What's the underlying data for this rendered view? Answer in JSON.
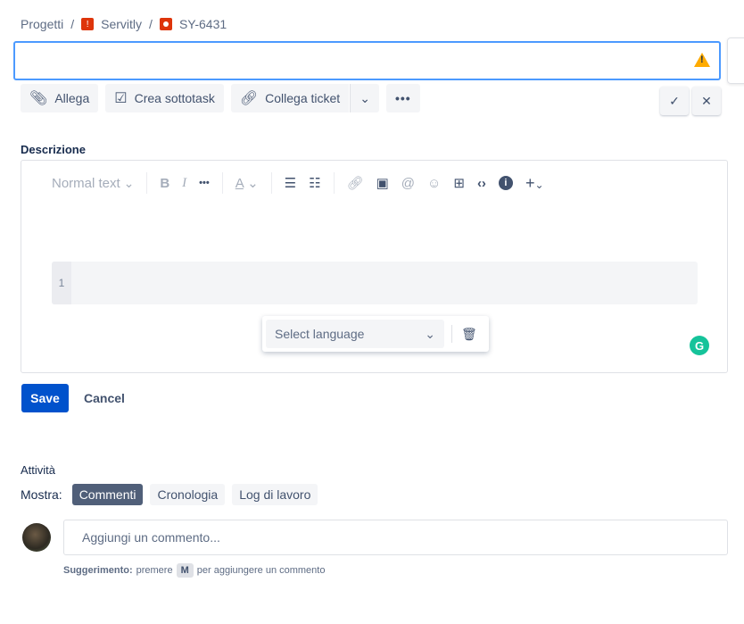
{
  "breadcrumb": {
    "root": "Progetti",
    "project": "Servitly",
    "issue": "SY-6431",
    "separator": "/"
  },
  "title_input": {
    "value": ""
  },
  "actions": {
    "attach": "Allega",
    "subtask": "Crea sottotask",
    "link": "Collega ticket"
  },
  "description": {
    "label": "Descrizione",
    "text_style": "Normal text",
    "line_number": "1",
    "select_language": "Select language"
  },
  "buttons": {
    "save": "Save",
    "cancel": "Cancel"
  },
  "activity": {
    "title": "Attività",
    "show_label": "Mostra:",
    "filters": [
      "Commenti",
      "Cronologia",
      "Log di lavoro"
    ]
  },
  "comment": {
    "placeholder": "Aggiungi un commento...",
    "hint_bold": "Suggerimento:",
    "hint_pre": "premere",
    "hint_key": "M",
    "hint_post": "per aggiungere un commento"
  },
  "colors": {
    "primary": "#0052cc",
    "focus": "#4c9aff",
    "warning": "#ffab00"
  }
}
